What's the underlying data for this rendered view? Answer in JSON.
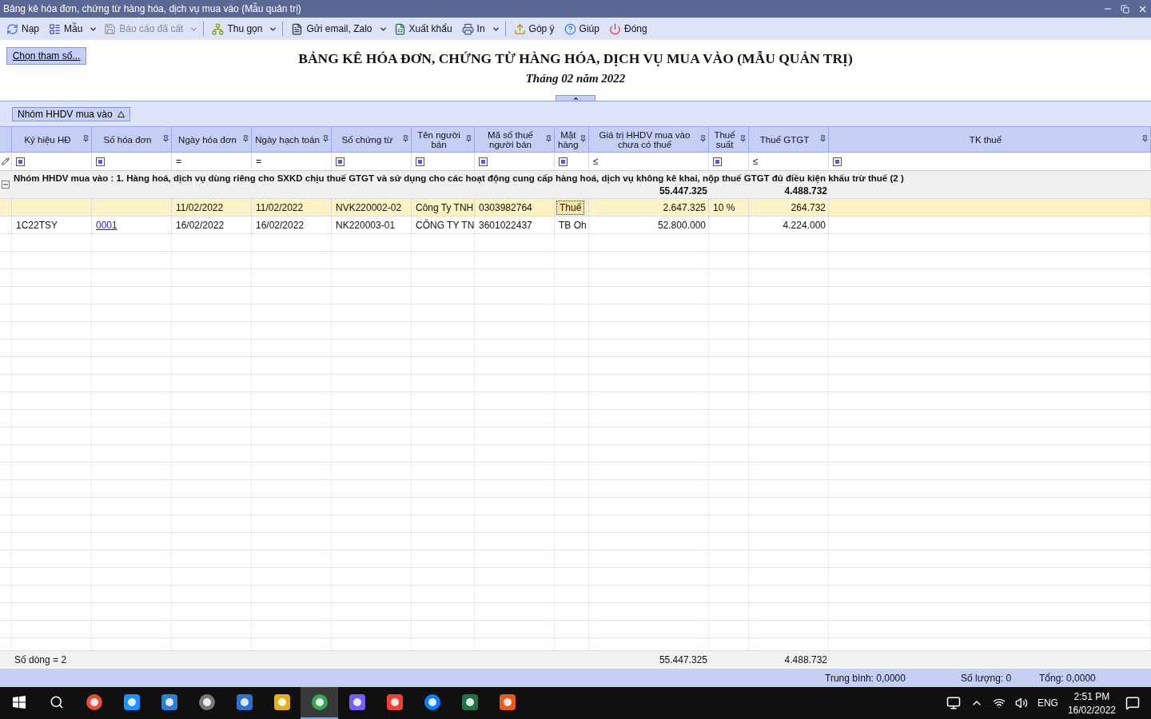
{
  "window": {
    "title": "Bảng kê hóa đơn, chứng từ hàng hóa, dịch vụ mua vào (Mẫu quản trị)"
  },
  "toolbar": [
    {
      "label": "Nạp",
      "dropdown": false,
      "disabled": false,
      "separator": false
    },
    {
      "label": "Mẫu",
      "dropdown": true,
      "disabled": false,
      "separator": false
    },
    {
      "label": "Báo cáo đã cất",
      "dropdown": true,
      "disabled": true,
      "separator": false
    },
    {
      "label": "Thu gọn",
      "dropdown": true,
      "disabled": false,
      "separator": true
    },
    {
      "label": "Gửi email, Zalo",
      "dropdown": true,
      "disabled": false,
      "separator": true
    },
    {
      "label": "Xuất khẩu",
      "dropdown": false,
      "disabled": false,
      "separator": false
    },
    {
      "label": "In",
      "dropdown": true,
      "disabled": false,
      "separator": false
    },
    {
      "label": "Góp ý",
      "dropdown": false,
      "disabled": false,
      "separator": true
    },
    {
      "label": "Giúp",
      "dropdown": false,
      "disabled": false,
      "separator": false
    },
    {
      "label": "Đóng",
      "dropdown": false,
      "disabled": false,
      "separator": false
    }
  ],
  "params_button": "Chọn tham số...",
  "report": {
    "title": "BẢNG KÊ HÓA ĐƠN, CHỨNG TỪ HÀNG HÓA, DỊCH VỤ MUA VÀO (MẪU QUẢN TRỊ)",
    "subtitle": "Tháng 02 năm 2022"
  },
  "group_panel": {
    "chip": "Nhóm HHDV mua vào"
  },
  "columns": [
    {
      "label": "Ký hiệu HĐ",
      "kind": "text",
      "filter": {
        "kind": "checkbox",
        "checked": true
      }
    },
    {
      "label": "Số hóa đơn",
      "kind": "text",
      "filter": {
        "kind": "checkbox",
        "checked": true
      }
    },
    {
      "label": "Ngày hóa đơn",
      "kind": "text",
      "filter": {
        "kind": "operator",
        "symbol": "="
      }
    },
    {
      "label": "Ngày hạch toán",
      "kind": "text",
      "filter": {
        "kind": "operator",
        "symbol": "="
      }
    },
    {
      "label": "Số chứng từ",
      "kind": "text",
      "filter": {
        "kind": "checkbox",
        "checked": true
      }
    },
    {
      "label": "Tên người bán",
      "kind": "text",
      "filter": {
        "kind": "checkbox",
        "checked": true
      }
    },
    {
      "label": "Mã số thuế người bán",
      "kind": "text",
      "filter": {
        "kind": "checkbox",
        "checked": true
      }
    },
    {
      "label": "Mặt hàng",
      "kind": "text",
      "filter": {
        "kind": "checkbox",
        "checked": true
      }
    },
    {
      "label": "Giá trị HHDV mua vào chưa có thuế",
      "kind": "amount",
      "filter": {
        "kind": "operator",
        "symbol": "≤"
      }
    },
    {
      "label": "Thuế suất",
      "kind": "text",
      "filter": {
        "kind": "checkbox",
        "checked": true
      }
    },
    {
      "label": "Thuế GTGT",
      "kind": "amount",
      "filter": {
        "kind": "operator",
        "symbol": "≤"
      }
    },
    {
      "label": "TK thuế",
      "kind": "text",
      "filter": {
        "kind": "checkbox",
        "checked": true
      }
    }
  ],
  "group": {
    "label": "Nhóm HHDV mua vào : 1. Hàng hoá, dịch vụ dùng riêng cho SXKD chịu thuế GTGT và sử dụng cho các hoạt động cung cấp hàng hoá, dịch vụ không kê khai, nộp thuế GTGT đủ điều kiện khấu trừ thuế (2 )",
    "expanded": true,
    "value_total": "55.447.325",
    "vat_total": "4.488.732"
  },
  "rows": [
    {
      "selected": true,
      "cells": [
        null,
        null,
        {
          "text": "11/02/2022",
          "kind": "plain"
        },
        {
          "text": "11/02/2022",
          "kind": "plain"
        },
        {
          "text": "NVK220002-02",
          "kind": "plain"
        },
        {
          "text": "Công Ty TNH",
          "kind": "plain"
        },
        {
          "text": "0303982764",
          "kind": "plain"
        },
        {
          "text": "Thuế",
          "kind": "focused"
        },
        {
          "text": "2.647.325",
          "kind": "plain"
        },
        {
          "text": "10 %",
          "kind": "plain"
        },
        {
          "text": "264.732",
          "kind": "plain"
        },
        null
      ]
    },
    {
      "selected": false,
      "cells": [
        {
          "text": "1C22TSY",
          "kind": "plain"
        },
        {
          "text": "0001",
          "kind": "link"
        },
        {
          "text": "16/02/2022",
          "kind": "plain"
        },
        {
          "text": "16/02/2022",
          "kind": "plain"
        },
        {
          "text": "NK220003-01",
          "kind": "plain"
        },
        {
          "text": "CÔNG TY TN",
          "kind": "plain"
        },
        {
          "text": "3601022437",
          "kind": "plain"
        },
        {
          "text": "TB Oh",
          "kind": "plain"
        },
        {
          "text": "52.800.000",
          "kind": "plain"
        },
        null,
        {
          "text": "4.224.000",
          "kind": "plain"
        },
        null
      ]
    }
  ],
  "footer": {
    "row_count": "Số dòng = 2",
    "value_total": "55.447.325",
    "vat_total": "4.488.732"
  },
  "status_bar": [
    "Trung bình: 0,0000",
    "Số lượng: 0",
    "Tổng: 0,0000"
  ],
  "taskbar": {
    "apps": [
      {
        "selected": false
      },
      {
        "selected": false
      },
      {
        "selected": false
      },
      {
        "selected": false
      },
      {
        "selected": false
      },
      {
        "selected": false
      },
      {
        "selected": true
      },
      {
        "selected": false
      },
      {
        "selected": false
      },
      {
        "selected": false
      },
      {
        "selected": false
      },
      {
        "selected": false
      }
    ],
    "language": "ENG",
    "time": "2:51 PM",
    "date": "16/02/2022"
  }
}
